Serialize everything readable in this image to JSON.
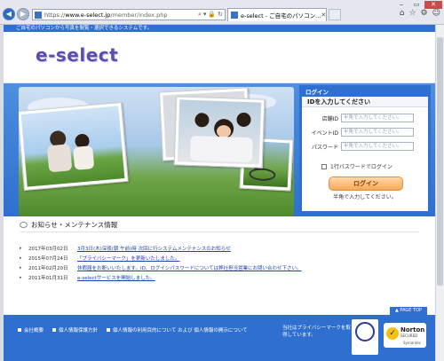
{
  "browser": {
    "address": {
      "scheme": "https://",
      "host": "www.e-select.jp",
      "path": "/member/index.php"
    },
    "tab_title": "e-select - ご自宅のパソコン...",
    "win_controls": [
      "‒",
      "▭",
      "✕"
    ],
    "icons": [
      "back-arrow-icon",
      "forward-arrow-icon",
      "search-icon",
      "lock-icon",
      "refresh-icon",
      "home-icon",
      "star-icon",
      "gear-icon",
      "smiley-icon"
    ]
  },
  "site": {
    "tagline": "ご自宅のパソコンから写真を閲覧・選択できるシステムです。",
    "logo": "e-select"
  },
  "login": {
    "header": "ログイン",
    "subheader": "IDを入力してください",
    "fields": [
      {
        "label": "店舗ID",
        "placeholder": "半角で入力してください。"
      },
      {
        "label": "イベントID",
        "placeholder": "半角で入力してください。"
      },
      {
        "label": "パスワード",
        "placeholder": "半角で入力してください。"
      }
    ],
    "checkbox_label": "1行パスワードでログイン",
    "button_label": "ログイン",
    "note": "半角で入力してください。"
  },
  "news": {
    "title": "お知らせ・メンテナンス情報",
    "items": [
      {
        "date": "2017年03月02日",
        "text": "3月3日(木)深夜(朝 午前)時 次回に行システムメンテナンスのお知らせ"
      },
      {
        "date": "2015年07月24日",
        "text": "「プライバシーマーク」を更新いたしました。"
      },
      {
        "date": "2011年02月20日",
        "text": "休暇届をお断いいたします。ID、ログインパスワードについては弊社担当営業にお問い合わせ下さい。"
      },
      {
        "date": "2011年01月31日",
        "text": "e-selectサービスを開始しました。"
      }
    ]
  },
  "footer": {
    "pagetop": "▲ PAGE TOP",
    "links": [
      "会社概要",
      "個人情報保護方針",
      "個人情報の利用目的について および 個人情報の開示について"
    ],
    "privacy_text": "当社はプライバシーマークを取得しています。",
    "norton_title": "Norton",
    "norton_sub": "SECURED",
    "norton_by": "Symantec"
  }
}
